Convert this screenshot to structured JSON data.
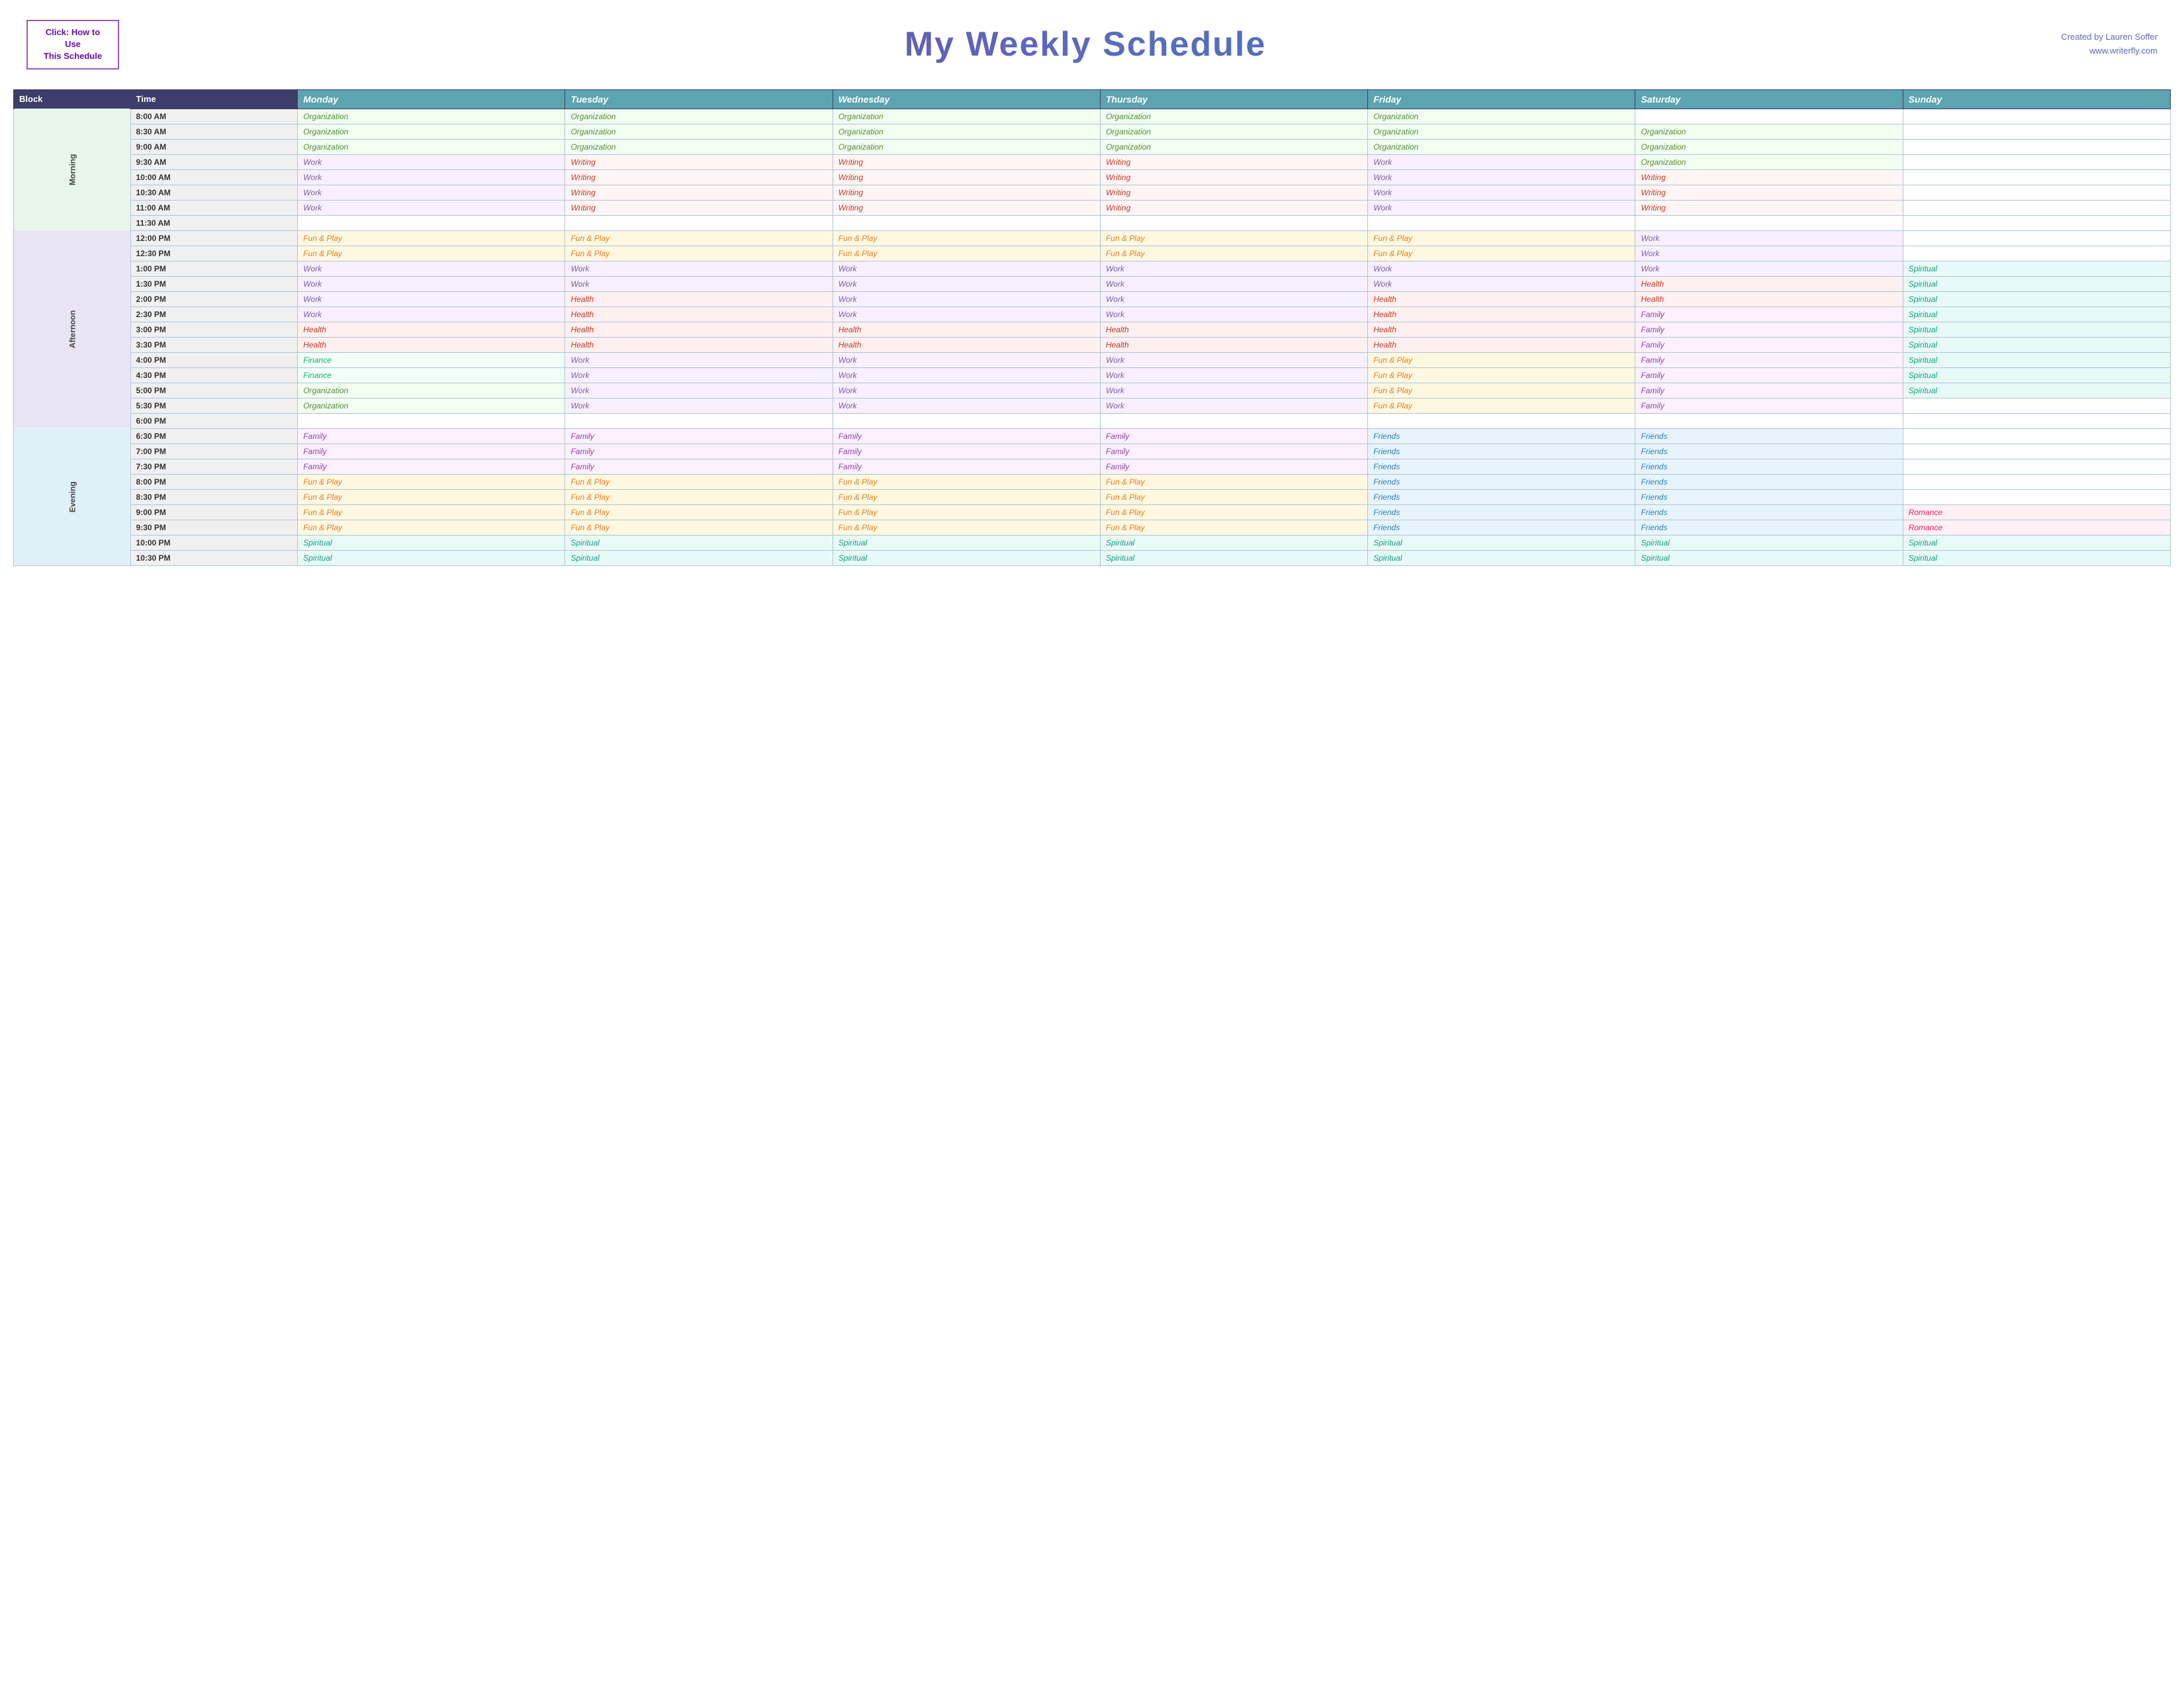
{
  "header": {
    "click_label_line1": "Click:  How to Use",
    "click_label_line2": "This Schedule",
    "title": "My Weekly Schedule",
    "creator_name": "Created by Lauren Soffer",
    "creator_url": "www.writerfly.com"
  },
  "table": {
    "headers": {
      "block": "Block",
      "time": "Time",
      "monday": "Monday",
      "tuesday": "Tuesday",
      "wednesday": "Wednesday",
      "thursday": "Thursday",
      "friday": "Friday",
      "saturday": "Saturday",
      "sunday": "Sunday"
    },
    "blocks": {
      "morning": "Morning",
      "afternoon": "Afternoon",
      "evening": "Evening"
    },
    "rows": [
      {
        "block": "Morning",
        "time": "8:00 AM",
        "mon": "Organization",
        "tue": "Organization",
        "wed": "Organization",
        "thu": "Organization",
        "fri": "Organization",
        "sat": "",
        "sun": ""
      },
      {
        "block": "Morning",
        "time": "8:30 AM",
        "mon": "Organization",
        "tue": "Organization",
        "wed": "Organization",
        "thu": "Organization",
        "fri": "Organization",
        "sat": "Organization",
        "sun": ""
      },
      {
        "block": "Morning",
        "time": "9:00 AM",
        "mon": "Organization",
        "tue": "Organization",
        "wed": "Organization",
        "thu": "Organization",
        "fri": "Organization",
        "sat": "Organization",
        "sun": ""
      },
      {
        "block": "Morning",
        "time": "9:30 AM",
        "mon": "Work",
        "tue": "Writing",
        "wed": "Writing",
        "thu": "Writing",
        "fri": "Work",
        "sat": "Organization",
        "sun": ""
      },
      {
        "block": "Morning",
        "time": "10:00 AM",
        "mon": "Work",
        "tue": "Writing",
        "wed": "Writing",
        "thu": "Writing",
        "fri": "Work",
        "sat": "Writing",
        "sun": ""
      },
      {
        "block": "Morning",
        "time": "10:30 AM",
        "mon": "Work",
        "tue": "Writing",
        "wed": "Writing",
        "thu": "Writing",
        "fri": "Work",
        "sat": "Writing",
        "sun": ""
      },
      {
        "block": "Morning",
        "time": "11:00 AM",
        "mon": "Work",
        "tue": "Writing",
        "wed": "Writing",
        "thu": "Writing",
        "fri": "Work",
        "sat": "Writing",
        "sun": ""
      },
      {
        "block": "Morning",
        "time": "11:30 AM",
        "mon": "",
        "tue": "",
        "wed": "",
        "thu": "",
        "fri": "",
        "sat": "",
        "sun": ""
      },
      {
        "block": "Afternoon",
        "time": "12:00 PM",
        "mon": "Fun & Play",
        "tue": "Fun & Play",
        "wed": "Fun & Play",
        "thu": "Fun & Play",
        "fri": "Fun & Play",
        "sat": "Work",
        "sun": ""
      },
      {
        "block": "Afternoon",
        "time": "12:30 PM",
        "mon": "Fun & Play",
        "tue": "Fun & Play",
        "wed": "Fun & Play",
        "thu": "Fun & Play",
        "fri": "Fun & Play",
        "sat": "Work",
        "sun": ""
      },
      {
        "block": "Afternoon",
        "time": "1:00 PM",
        "mon": "Work",
        "tue": "Work",
        "wed": "Work",
        "thu": "Work",
        "fri": "Work",
        "sat": "Work",
        "sun": "Spiritual"
      },
      {
        "block": "Afternoon",
        "time": "1:30 PM",
        "mon": "Work",
        "tue": "Work",
        "wed": "Work",
        "thu": "Work",
        "fri": "Work",
        "sat": "Health",
        "sun": "Spiritual"
      },
      {
        "block": "Afternoon",
        "time": "2:00 PM",
        "mon": "Work",
        "tue": "Health",
        "wed": "Work",
        "thu": "Work",
        "fri": "Health",
        "sat": "Health",
        "sun": "Spiritual"
      },
      {
        "block": "Afternoon",
        "time": "2:30 PM",
        "mon": "Work",
        "tue": "Health",
        "wed": "Work",
        "thu": "Work",
        "fri": "Health",
        "sat": "Family",
        "sun": "Spiritual"
      },
      {
        "block": "Afternoon",
        "time": "3:00 PM",
        "mon": "Health",
        "tue": "Health",
        "wed": "Health",
        "thu": "Health",
        "fri": "Health",
        "sat": "Family",
        "sun": "Spiritual"
      },
      {
        "block": "Afternoon",
        "time": "3:30 PM",
        "mon": "Health",
        "tue": "Health",
        "wed": "Health",
        "thu": "Health",
        "fri": "Health",
        "sat": "Family",
        "sun": "Spiritual"
      },
      {
        "block": "Afternoon",
        "time": "4:00 PM",
        "mon": "Finance",
        "tue": "Work",
        "wed": "Work",
        "thu": "Work",
        "fri": "Fun & Play",
        "sat": "Family",
        "sun": "Spiritual"
      },
      {
        "block": "Afternoon",
        "time": "4:30 PM",
        "mon": "Finance",
        "tue": "Work",
        "wed": "Work",
        "thu": "Work",
        "fri": "Fun & Play",
        "sat": "Family",
        "sun": "Spiritual"
      },
      {
        "block": "Afternoon",
        "time": "5:00 PM",
        "mon": "Organization",
        "tue": "Work",
        "wed": "Work",
        "thu": "Work",
        "fri": "Fun & Play",
        "sat": "Family",
        "sun": "Spiritual"
      },
      {
        "block": "Afternoon",
        "time": "5:30 PM",
        "mon": "Organization",
        "tue": "Work",
        "wed": "Work",
        "thu": "Work",
        "fri": "Fun & Play",
        "sat": "Family",
        "sun": ""
      },
      {
        "block": "Afternoon",
        "time": "6:00 PM",
        "mon": "",
        "tue": "",
        "wed": "",
        "thu": "",
        "fri": "",
        "sat": "",
        "sun": ""
      },
      {
        "block": "Evening",
        "time": "6:30 PM",
        "mon": "Family",
        "tue": "Family",
        "wed": "Family",
        "thu": "Family",
        "fri": "Friends",
        "sat": "Friends",
        "sun": ""
      },
      {
        "block": "Evening",
        "time": "7:00 PM",
        "mon": "Family",
        "tue": "Family",
        "wed": "Family",
        "thu": "Family",
        "fri": "Friends",
        "sat": "Friends",
        "sun": ""
      },
      {
        "block": "Evening",
        "time": "7:30 PM",
        "mon": "Family",
        "tue": "Family",
        "wed": "Family",
        "thu": "Family",
        "fri": "Friends",
        "sat": "Friends",
        "sun": ""
      },
      {
        "block": "Evening",
        "time": "8:00 PM",
        "mon": "Fun & Play",
        "tue": "Fun & Play",
        "wed": "Fun & Play",
        "thu": "Fun & Play",
        "fri": "Friends",
        "sat": "Friends",
        "sun": ""
      },
      {
        "block": "Evening",
        "time": "8:30 PM",
        "mon": "Fun & Play",
        "tue": "Fun & Play",
        "wed": "Fun & Play",
        "thu": "Fun & Play",
        "fri": "Friends",
        "sat": "Friends",
        "sun": ""
      },
      {
        "block": "Evening",
        "time": "9:00 PM",
        "mon": "Fun & Play",
        "tue": "Fun & Play",
        "wed": "Fun & Play",
        "thu": "Fun & Play",
        "fri": "Friends",
        "sat": "Friends",
        "sun": "Romance"
      },
      {
        "block": "Evening",
        "time": "9:30 PM",
        "mon": "Fun & Play",
        "tue": "Fun & Play",
        "wed": "Fun & Play",
        "thu": "Fun & Play",
        "fri": "Friends",
        "sat": "Friends",
        "sun": "Romance"
      },
      {
        "block": "Evening",
        "time": "10:00 PM",
        "mon": "Spiritual",
        "tue": "Spiritual",
        "wed": "Spiritual",
        "thu": "Spiritual",
        "fri": "Spiritual",
        "sat": "Spiritual",
        "sun": "Spiritual"
      },
      {
        "block": "Evening",
        "time": "10:30 PM",
        "mon": "Spiritual",
        "tue": "Spiritual",
        "wed": "Spiritual",
        "thu": "Spiritual",
        "fri": "Spiritual",
        "sat": "Spiritual",
        "sun": "Spiritual"
      }
    ]
  }
}
